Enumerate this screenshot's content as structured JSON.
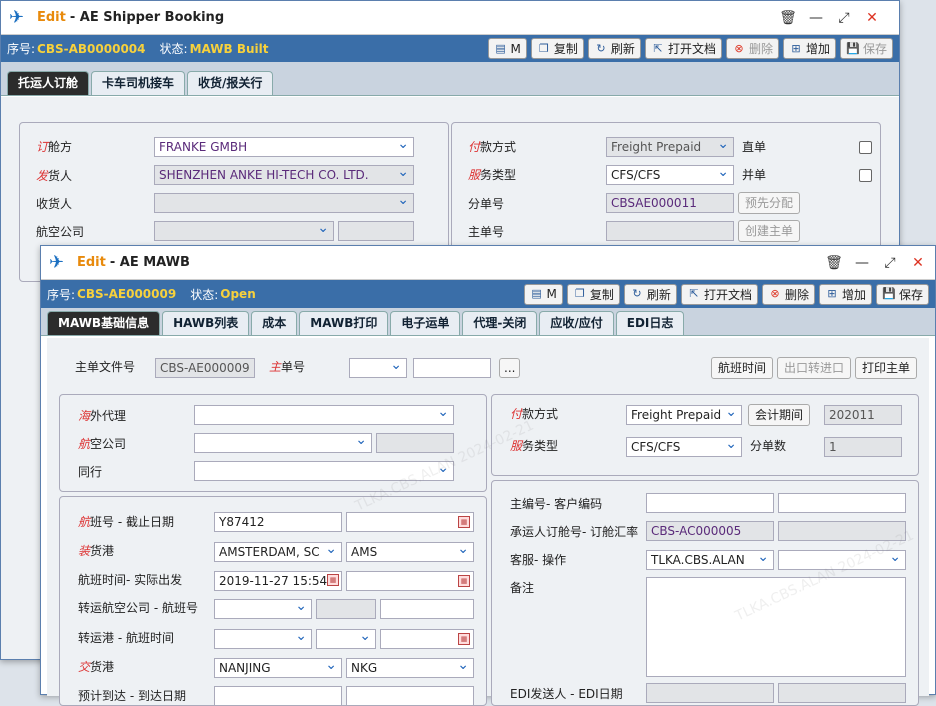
{
  "w1": {
    "edit": "Edit",
    "title": "- AE Shipper Booking",
    "seq_label": "序号:",
    "seq": "CBS-AB0000004",
    "status_label": "状态:",
    "status": "MAWB Built",
    "actions": [
      "M",
      "复制",
      "刷新",
      "打开文档",
      "删除",
      "增加",
      "保存"
    ],
    "tabs": [
      "托运人订舱",
      "卡车司机接车",
      "收货/报关行"
    ],
    "fields": {
      "booker_label_r": "订",
      "booker_label": "舱方",
      "booker": "FRANKE GMBH",
      "shipper_label_r": "发",
      "shipper_label": "货人",
      "shipper": "SHENZHEN ANKE HI-TECH CO. LTD.",
      "consignee_label": "收货人",
      "airline_label": "航空公司",
      "pay_label_r": "付",
      "pay_label": "款方式",
      "pay": "Freight Prepaid",
      "direct_label": "直单",
      "svc_label_r": "服",
      "svc_label": "务类型",
      "svc": "CFS/CFS",
      "merge_label": "并单",
      "hawb_label": "分单号",
      "hawb": "CBSAE000011",
      "prealloc": "预先分配",
      "mawb_label": "主单号",
      "create_mawb": "创建主单"
    }
  },
  "w2": {
    "edit": "Edit",
    "title": "- AE MAWB",
    "seq_label": "序号:",
    "seq": "CBS-AE000009",
    "status_label": "状态:",
    "status": "Open",
    "actions": [
      "M",
      "复制",
      "刷新",
      "打开文档",
      "删除",
      "增加",
      "保存"
    ],
    "tabs": [
      "MAWB基础信息",
      "HAWB列表",
      "成本",
      "MAWB打印",
      "电子运单",
      "代理-关闭",
      "应收/应付",
      "EDI日志"
    ],
    "top": {
      "file_label": "主单文件号",
      "file": "CBS-AE000009",
      "mawb_label_r": "主",
      "mawb_label": "单号",
      "dots": "...",
      "flight_time_btn": "航班时间",
      "transfer_btn": "出口转进口",
      "print_btn": "打印主单"
    },
    "left": {
      "oversea_r": "海",
      "oversea": "外代理",
      "airline_r": "航",
      "airline": "空公司",
      "peer": "同行",
      "flight_r": "航",
      "flight": "班号 - 截止日期",
      "flight_no": "Y87412",
      "dep_r": "装",
      "dep": "货港",
      "dep_port": "AMSTERDAM, SC",
      "dep_code": "AMS",
      "flight_time": "航班时间- 实际出发",
      "flight_dt": "2019-11-27 15:54",
      "transfer_airline": "转运航空公司 - 航班号",
      "transfer_port": "转运港 - 航班时间",
      "dest_r": "交",
      "dest": "货港",
      "dest_port": "NANJING",
      "dest_code": "NKG",
      "eta": "预计到达 - 到达日期"
    },
    "right": {
      "pay_r": "付",
      "pay": "款方式",
      "pay_val": "Freight Prepaid",
      "period_btn": "会计期间",
      "period": "202011",
      "svc_r": "服",
      "svc": "务类型",
      "svc_val": "CFS/CFS",
      "hcount_label": "分单数",
      "hcount": "1",
      "cust_code": "主编号- 客户编码",
      "booking_no": "承运人订舱号- 订舱汇率",
      "booking_val": "CBS-AC000005",
      "cs_op": "客服- 操作",
      "cs_val": "TLKA.CBS.ALAN",
      "remark": "备注",
      "edi": "EDI发送人 - EDI日期"
    }
  },
  "watermark": "TLKA.CBS.ALAN 2024-02-21"
}
